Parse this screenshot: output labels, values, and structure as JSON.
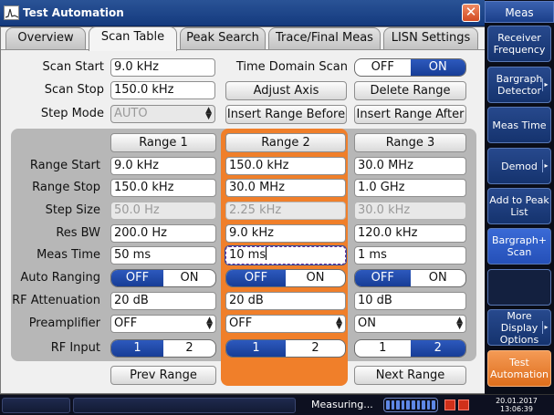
{
  "window": {
    "title": "Test Automation",
    "close_glyph": "✕"
  },
  "tabs": [
    {
      "label": "Overview"
    },
    {
      "label": "Scan Table"
    },
    {
      "label": "Peak Search"
    },
    {
      "label": "Trace/Final Meas"
    },
    {
      "label": "LISN Settings"
    }
  ],
  "scan": {
    "start_label": "Scan Start",
    "start_value": "9.0 kHz",
    "stop_label": "Scan Stop",
    "stop_value": "150.0 kHz",
    "step_mode_label": "Step Mode",
    "step_mode_value": "AUTO",
    "time_domain_label": "Time Domain Scan",
    "time_domain_off": "OFF",
    "time_domain_on": "ON",
    "time_domain_state": "ON"
  },
  "actions": {
    "adjust_axis": "Adjust Axis",
    "delete_range": "Delete Range",
    "insert_before": "Insert Range Before",
    "insert_after": "Insert Range After",
    "prev_range": "Prev Range",
    "next_range": "Next Range"
  },
  "row_labels": [
    "Range Start",
    "Range Stop",
    "Step Size",
    "Res BW",
    "Meas Time",
    "Auto Ranging",
    "RF Attenuation",
    "Preamplifier",
    "RF Input"
  ],
  "ranges": [
    {
      "name": "Range 1",
      "start": "9.0 kHz",
      "stop": "150.0 kHz",
      "step": "50.0 Hz",
      "res_bw": "200.0 Hz",
      "meas_time": "50 ms",
      "auto_off": "OFF",
      "auto_on": "ON",
      "auto_state": "OFF",
      "rf_att": "20 dB",
      "preamp": "OFF",
      "rf_in_1": "1",
      "rf_in_2": "2",
      "rf_in_state": "1"
    },
    {
      "name": "Range 2",
      "start": "150.0 kHz",
      "stop": "30.0 MHz",
      "step": "2.25 kHz",
      "res_bw": "9.0 kHz",
      "meas_time": "10 ms",
      "auto_off": "OFF",
      "auto_on": "ON",
      "auto_state": "OFF",
      "rf_att": "20 dB",
      "preamp": "OFF",
      "rf_in_1": "1",
      "rf_in_2": "2",
      "rf_in_state": "1"
    },
    {
      "name": "Range 3",
      "start": "30.0 MHz",
      "stop": "1.0 GHz",
      "step": "30.0 kHz",
      "res_bw": "120.0 kHz",
      "meas_time": "1 ms",
      "auto_off": "OFF",
      "auto_on": "ON",
      "auto_state": "OFF",
      "rf_att": "10 dB",
      "preamp": "ON",
      "rf_in_1": "1",
      "rf_in_2": "2",
      "rf_in_state": "2"
    }
  ],
  "sidebar": {
    "header": "Meas",
    "items": [
      {
        "label": "Receiver Frequency"
      },
      {
        "label": "Bargraph Detector"
      },
      {
        "label": "Meas Time"
      },
      {
        "label": "Demod"
      },
      {
        "label": "Add to Peak List"
      },
      {
        "label": "Bargraph+ Scan"
      },
      {
        "label": ""
      },
      {
        "label": "More Display Options"
      },
      {
        "label": "Test Automation"
      }
    ]
  },
  "status": {
    "text": "Measuring...",
    "date": "20.01.2017",
    "time": "13:06:39"
  },
  "colors": {
    "accent_orange": "#f07f2a",
    "active_blue": "#1f4aa8",
    "title_blue": "#1f4a92"
  }
}
